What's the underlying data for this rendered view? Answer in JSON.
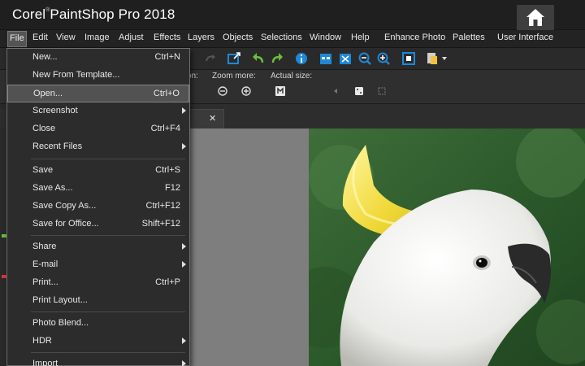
{
  "app": {
    "title_a": "Corel",
    "reg": "®",
    "title_b": "PaintShop",
    "title_c": "Pro 2018"
  },
  "menubar": [
    {
      "key": "file",
      "label": "File"
    },
    {
      "key": "edit",
      "label": "Edit"
    },
    {
      "key": "view",
      "label": "View"
    },
    {
      "key": "image",
      "label": "Image"
    },
    {
      "key": "adjust",
      "label": "Adjust"
    },
    {
      "key": "effects",
      "label": "Effects"
    },
    {
      "key": "layers",
      "label": "Layers"
    },
    {
      "key": "objects",
      "label": "Objects"
    },
    {
      "key": "selections",
      "label": "Selections"
    },
    {
      "key": "window",
      "label": "Window"
    },
    {
      "key": "help",
      "label": "Help"
    },
    {
      "key": "enhance-photo",
      "label": "Enhance Photo"
    },
    {
      "key": "palettes",
      "label": "Palettes"
    },
    {
      "key": "user-interface",
      "label": "User Interface"
    }
  ],
  "options_bar": {
    "partial_label": "on:",
    "zoom_more": "Zoom more:",
    "actual_size": "Actual size:"
  },
  "doc_tab": {
    "close": "✕"
  },
  "file_menu": {
    "items": [
      {
        "key": "new",
        "label": "New...",
        "shortcut": "Ctrl+N"
      },
      {
        "key": "new-from-template",
        "label": "New From Template...",
        "shortcut": ""
      },
      {
        "key": "open",
        "label": "Open...",
        "shortcut": "Ctrl+O",
        "highlighted": true
      },
      {
        "key": "screenshot",
        "label": "Screenshot",
        "submenu": true
      },
      {
        "key": "close",
        "label": "Close",
        "shortcut": "Ctrl+F4"
      },
      {
        "key": "recent-files",
        "label": "Recent Files",
        "submenu": true
      },
      {
        "key": "save",
        "label": "Save",
        "shortcut": "Ctrl+S"
      },
      {
        "key": "save-as",
        "label": "Save As...",
        "shortcut": "F12"
      },
      {
        "key": "save-copy-as",
        "label": "Save Copy As...",
        "shortcut": "Ctrl+F12"
      },
      {
        "key": "save-for-office",
        "label": "Save for Office...",
        "shortcut": "Shift+F12"
      },
      {
        "key": "share",
        "label": "Share",
        "submenu": true
      },
      {
        "key": "email",
        "label": "E-mail",
        "submenu": true
      },
      {
        "key": "print",
        "label": "Print...",
        "shortcut": "Ctrl+P"
      },
      {
        "key": "print-layout",
        "label": "Print Layout...",
        "shortcut": ""
      },
      {
        "key": "photo-blend",
        "label": "Photo Blend...",
        "shortcut": ""
      },
      {
        "key": "hdr",
        "label": "HDR",
        "submenu": true
      },
      {
        "key": "import",
        "label": "Import",
        "submenu": true
      }
    ]
  },
  "icons": {
    "home": "home-icon",
    "undo": "undo-icon",
    "redo": "redo-icon",
    "info": "info-icon",
    "zoom_in": "zoom-in-icon",
    "zoom_out": "zoom-out-icon",
    "fit": "fit-window-icon",
    "actual": "actual-size-icon"
  },
  "colors": {
    "titlebar": "#1f1f1f",
    "menubar": "#232323",
    "menu_highlight": "#525252",
    "workspace": "#7e7e7e",
    "accent_blue": "#1e88d6",
    "accent_green": "#6bbf3a"
  }
}
